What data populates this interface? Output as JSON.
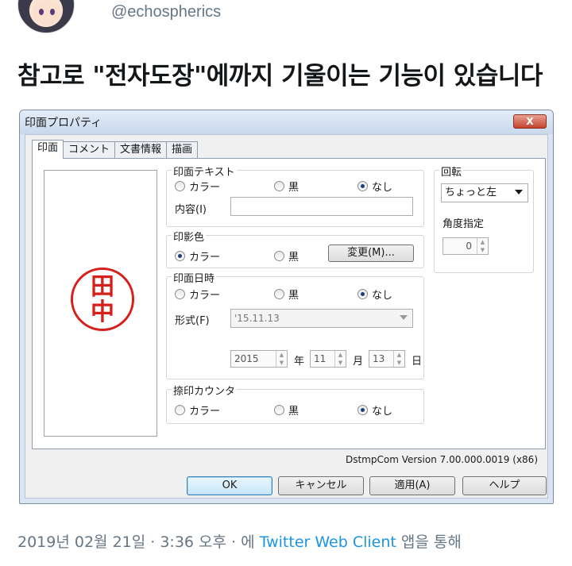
{
  "tweet": {
    "handle": "@echospherics",
    "text": "참고로 \"전자도장\"에까지 기울이는 기능이 있습니다",
    "footer_prefix": "2019년 02월 21일 · 3:36 오후 · 에 ",
    "footer_client": "Twitter Web Client",
    "footer_suffix": " 앱을 통해"
  },
  "dialog": {
    "title": "印面プロパティ",
    "close_label": "X",
    "tabs": [
      "印面",
      "コメント",
      "文書情報",
      "描画"
    ],
    "stamp_text_line1": "田",
    "stamp_text_line2": "中",
    "face_text": {
      "label": "印面テキスト",
      "options": [
        "カラー",
        "黒",
        "なし"
      ],
      "selected": "なし",
      "content_label": "内容(I)",
      "content_value": ""
    },
    "stamp_color": {
      "label": "印影色",
      "options": [
        "カラー",
        "黒"
      ],
      "selected": "カラー",
      "change_button": "変更(M)..."
    },
    "face_date": {
      "label": "印面日時",
      "options": [
        "カラー",
        "黒",
        "なし"
      ],
      "selected": "なし",
      "format_label": "形式(F)",
      "format_value": "'15.11.13",
      "year_value": "2015",
      "year_unit": "年",
      "month_value": "11",
      "month_unit": "月",
      "day_value": "13",
      "day_unit": "日"
    },
    "counter": {
      "label": "捺印カウンタ",
      "options": [
        "カラー",
        "黒",
        "なし"
      ],
      "selected": "なし"
    },
    "rotation": {
      "label": "回転",
      "selected": "ちょっと左",
      "angle_label": "角度指定",
      "angle_value": "0"
    },
    "version": "DstmpCom Version 7.00.000.0019 (x86)",
    "buttons": {
      "ok": "OK",
      "cancel": "キャンセル",
      "apply": "適用(A)",
      "help": "ヘルプ"
    }
  },
  "colors": {
    "link": "#1b95e0",
    "muted": "#657786",
    "stamp_red": "#d6201c"
  }
}
